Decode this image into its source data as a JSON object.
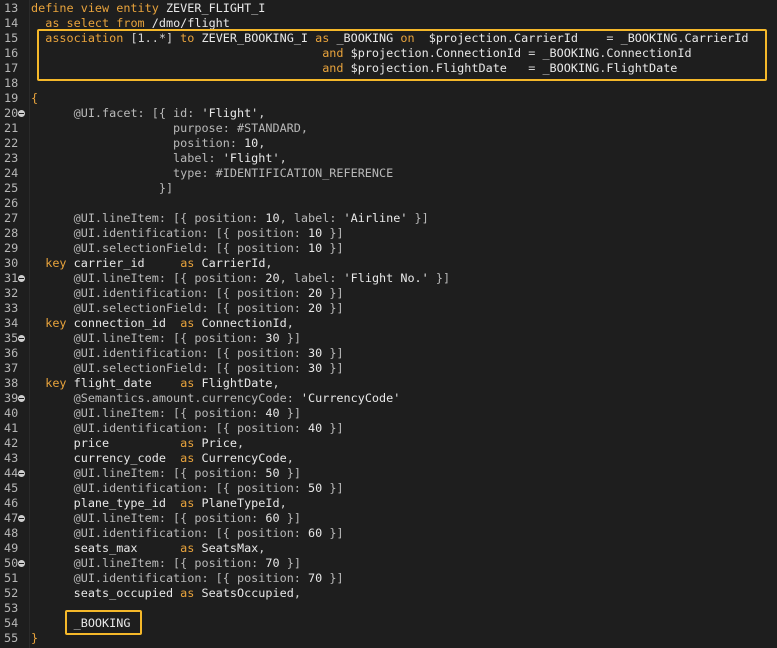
{
  "editor": {
    "lines": [
      {
        "n": "13",
        "fold": false,
        "tokens": [
          [
            "kw",
            "define view entity "
          ],
          [
            "txt",
            "ZEVER_FLIGHT_I"
          ]
        ]
      },
      {
        "n": "14",
        "fold": false,
        "tokens": [
          [
            "txt",
            "  "
          ],
          [
            "kw",
            "as select from "
          ],
          [
            "txt",
            "/dmo/flight"
          ]
        ]
      },
      {
        "n": "15",
        "fold": false,
        "tokens": [
          [
            "txt",
            "  "
          ],
          [
            "kw",
            "association "
          ],
          [
            "pun",
            "[1..*] "
          ],
          [
            "kw",
            "to "
          ],
          [
            "txt",
            "ZEVER_BOOKING_I "
          ],
          [
            "kw",
            "as "
          ],
          [
            "txt",
            "_BOOKING "
          ],
          [
            "kw",
            "on  "
          ],
          [
            "txt",
            "$projection"
          ],
          [
            "pun",
            "."
          ],
          [
            "txt",
            "CarrierId    "
          ],
          [
            "pun",
            "= "
          ],
          [
            "txt",
            "_BOOKING"
          ],
          [
            "pun",
            "."
          ],
          [
            "txt",
            "CarrierId"
          ]
        ]
      },
      {
        "n": "16",
        "fold": false,
        "tokens": [
          [
            "txt",
            "                                         "
          ],
          [
            "kw",
            "and "
          ],
          [
            "txt",
            "$projection"
          ],
          [
            "pun",
            "."
          ],
          [
            "txt",
            "ConnectionId "
          ],
          [
            "pun",
            "= "
          ],
          [
            "txt",
            "_BOOKING"
          ],
          [
            "pun",
            "."
          ],
          [
            "txt",
            "ConnectionId"
          ]
        ]
      },
      {
        "n": "17",
        "fold": false,
        "tokens": [
          [
            "txt",
            "                                         "
          ],
          [
            "kw",
            "and "
          ],
          [
            "txt",
            "$projection"
          ],
          [
            "pun",
            "."
          ],
          [
            "txt",
            "FlightDate   "
          ],
          [
            "pun",
            "= "
          ],
          [
            "txt",
            "_BOOKING"
          ],
          [
            "pun",
            "."
          ],
          [
            "txt",
            "FlightDate"
          ]
        ]
      },
      {
        "n": "18",
        "fold": false,
        "tokens": []
      },
      {
        "n": "19",
        "fold": false,
        "tokens": [
          [
            "op",
            "{"
          ]
        ]
      },
      {
        "n": "20",
        "fold": true,
        "tokens": [
          [
            "txt",
            "      "
          ],
          [
            "ann",
            "@UI.facet: [{ id: "
          ],
          [
            "str",
            "'Flight'"
          ],
          [
            "pun",
            ","
          ]
        ]
      },
      {
        "n": "21",
        "fold": false,
        "tokens": [
          [
            "txt",
            "                    "
          ],
          [
            "ann",
            "purpose: #STANDARD,"
          ]
        ]
      },
      {
        "n": "22",
        "fold": false,
        "tokens": [
          [
            "txt",
            "                    "
          ],
          [
            "ann",
            "position: "
          ],
          [
            "num",
            "10"
          ],
          [
            "pun",
            ","
          ]
        ]
      },
      {
        "n": "23",
        "fold": false,
        "tokens": [
          [
            "txt",
            "                    "
          ],
          [
            "ann",
            "label: "
          ],
          [
            "str",
            "'Flight'"
          ],
          [
            "pun",
            ","
          ]
        ]
      },
      {
        "n": "24",
        "fold": false,
        "tokens": [
          [
            "txt",
            "                    "
          ],
          [
            "ann",
            "type: #IDENTIFICATION_REFERENCE"
          ]
        ]
      },
      {
        "n": "25",
        "fold": false,
        "tokens": [
          [
            "txt",
            "                  "
          ],
          [
            "ann",
            "}]"
          ]
        ]
      },
      {
        "n": "26",
        "fold": false,
        "tokens": []
      },
      {
        "n": "27",
        "fold": false,
        "tokens": [
          [
            "txt",
            "      "
          ],
          [
            "ann",
            "@UI.lineItem: [{ position: "
          ],
          [
            "num",
            "10"
          ],
          [
            "ann",
            ", label: "
          ],
          [
            "str",
            "'Airline'"
          ],
          [
            "ann",
            " }]"
          ]
        ]
      },
      {
        "n": "28",
        "fold": false,
        "tokens": [
          [
            "txt",
            "      "
          ],
          [
            "ann",
            "@UI.identification: [{ position: "
          ],
          [
            "num",
            "10"
          ],
          [
            "ann",
            " }]"
          ]
        ]
      },
      {
        "n": "29",
        "fold": false,
        "tokens": [
          [
            "txt",
            "      "
          ],
          [
            "ann",
            "@UI.selectionField: [{ position: "
          ],
          [
            "num",
            "10"
          ],
          [
            "ann",
            " }]"
          ]
        ]
      },
      {
        "n": "30",
        "fold": false,
        "tokens": [
          [
            "txt",
            "  "
          ],
          [
            "kw",
            "key "
          ],
          [
            "txt",
            "carrier_id     "
          ],
          [
            "kw",
            "as "
          ],
          [
            "txt",
            "CarrierId"
          ],
          [
            "pun",
            ","
          ]
        ]
      },
      {
        "n": "31",
        "fold": true,
        "tokens": [
          [
            "txt",
            "      "
          ],
          [
            "ann",
            "@UI.lineItem: [{ position: "
          ],
          [
            "num",
            "20"
          ],
          [
            "ann",
            ", label: "
          ],
          [
            "str",
            "'Flight No.'"
          ],
          [
            "ann",
            " }]"
          ]
        ]
      },
      {
        "n": "32",
        "fold": false,
        "tokens": [
          [
            "txt",
            "      "
          ],
          [
            "ann",
            "@UI.identification: [{ position: "
          ],
          [
            "num",
            "20"
          ],
          [
            "ann",
            " }]"
          ]
        ]
      },
      {
        "n": "33",
        "fold": false,
        "tokens": [
          [
            "txt",
            "      "
          ],
          [
            "ann",
            "@UI.selectionField: [{ position: "
          ],
          [
            "num",
            "20"
          ],
          [
            "ann",
            " }]"
          ]
        ]
      },
      {
        "n": "34",
        "fold": false,
        "tokens": [
          [
            "txt",
            "  "
          ],
          [
            "kw",
            "key "
          ],
          [
            "txt",
            "connection_id  "
          ],
          [
            "kw",
            "as "
          ],
          [
            "txt",
            "ConnectionId"
          ],
          [
            "pun",
            ","
          ]
        ]
      },
      {
        "n": "35",
        "fold": true,
        "tokens": [
          [
            "txt",
            "      "
          ],
          [
            "ann",
            "@UI.lineItem: [{ position: "
          ],
          [
            "num",
            "30"
          ],
          [
            "ann",
            " }]"
          ]
        ]
      },
      {
        "n": "36",
        "fold": false,
        "tokens": [
          [
            "txt",
            "      "
          ],
          [
            "ann",
            "@UI.identification: [{ position: "
          ],
          [
            "num",
            "30"
          ],
          [
            "ann",
            " }]"
          ]
        ]
      },
      {
        "n": "37",
        "fold": false,
        "tokens": [
          [
            "txt",
            "      "
          ],
          [
            "ann",
            "@UI.selectionField: [{ position: "
          ],
          [
            "num",
            "30"
          ],
          [
            "ann",
            " }]"
          ]
        ]
      },
      {
        "n": "38",
        "fold": false,
        "tokens": [
          [
            "txt",
            "  "
          ],
          [
            "kw",
            "key "
          ],
          [
            "txt",
            "flight_date    "
          ],
          [
            "kw",
            "as "
          ],
          [
            "txt",
            "FlightDate"
          ],
          [
            "pun",
            ","
          ]
        ]
      },
      {
        "n": "39",
        "fold": true,
        "tokens": [
          [
            "txt",
            "      "
          ],
          [
            "ann",
            "@Semantics.amount.currencyCode: "
          ],
          [
            "str",
            "'CurrencyCode'"
          ]
        ]
      },
      {
        "n": "40",
        "fold": false,
        "tokens": [
          [
            "txt",
            "      "
          ],
          [
            "ann",
            "@UI.lineItem: [{ position: "
          ],
          [
            "num",
            "40"
          ],
          [
            "ann",
            " }]"
          ]
        ]
      },
      {
        "n": "41",
        "fold": false,
        "tokens": [
          [
            "txt",
            "      "
          ],
          [
            "ann",
            "@UI.identification: [{ position: "
          ],
          [
            "num",
            "40"
          ],
          [
            "ann",
            " }]"
          ]
        ]
      },
      {
        "n": "42",
        "fold": false,
        "tokens": [
          [
            "txt",
            "      price          "
          ],
          [
            "kw",
            "as "
          ],
          [
            "txt",
            "Price"
          ],
          [
            "pun",
            ","
          ]
        ]
      },
      {
        "n": "43",
        "fold": false,
        "tokens": [
          [
            "txt",
            "      currency_code  "
          ],
          [
            "kw",
            "as "
          ],
          [
            "txt",
            "CurrencyCode"
          ],
          [
            "pun",
            ","
          ]
        ]
      },
      {
        "n": "44",
        "fold": true,
        "tokens": [
          [
            "txt",
            "      "
          ],
          [
            "ann",
            "@UI.lineItem: [{ position: "
          ],
          [
            "num",
            "50"
          ],
          [
            "ann",
            " }]"
          ]
        ]
      },
      {
        "n": "45",
        "fold": false,
        "tokens": [
          [
            "txt",
            "      "
          ],
          [
            "ann",
            "@UI.identification: [{ position: "
          ],
          [
            "num",
            "50"
          ],
          [
            "ann",
            " }]"
          ]
        ]
      },
      {
        "n": "46",
        "fold": false,
        "tokens": [
          [
            "txt",
            "      plane_type_id  "
          ],
          [
            "kw",
            "as "
          ],
          [
            "txt",
            "PlaneTypeId"
          ],
          [
            "pun",
            ","
          ]
        ]
      },
      {
        "n": "47",
        "fold": true,
        "tokens": [
          [
            "txt",
            "      "
          ],
          [
            "ann",
            "@UI.lineItem: [{ position: "
          ],
          [
            "num",
            "60"
          ],
          [
            "ann",
            " }]"
          ]
        ]
      },
      {
        "n": "48",
        "fold": false,
        "tokens": [
          [
            "txt",
            "      "
          ],
          [
            "ann",
            "@UI.identification: [{ position: "
          ],
          [
            "num",
            "60"
          ],
          [
            "ann",
            " }]"
          ]
        ]
      },
      {
        "n": "49",
        "fold": false,
        "tokens": [
          [
            "txt",
            "      seats_max      "
          ],
          [
            "kw",
            "as "
          ],
          [
            "txt",
            "SeatsMax"
          ],
          [
            "pun",
            ","
          ]
        ]
      },
      {
        "n": "50",
        "fold": true,
        "tokens": [
          [
            "txt",
            "      "
          ],
          [
            "ann",
            "@UI.lineItem: [{ position: "
          ],
          [
            "num",
            "70"
          ],
          [
            "ann",
            " }]"
          ]
        ]
      },
      {
        "n": "51",
        "fold": false,
        "tokens": [
          [
            "txt",
            "      "
          ],
          [
            "ann",
            "@UI.identification: [{ position: "
          ],
          [
            "num",
            "70"
          ],
          [
            "ann",
            " }]"
          ]
        ]
      },
      {
        "n": "52",
        "fold": false,
        "tokens": [
          [
            "txt",
            "      seats_occupied "
          ],
          [
            "kw",
            "as "
          ],
          [
            "txt",
            "SeatsOccupied"
          ],
          [
            "pun",
            ","
          ]
        ]
      },
      {
        "n": "53",
        "fold": false,
        "tokens": []
      },
      {
        "n": "54",
        "fold": false,
        "tokens": [
          [
            "txt",
            "      _BOOKING"
          ]
        ]
      },
      {
        "n": "55",
        "fold": false,
        "tokens": [
          [
            "op",
            "}"
          ]
        ]
      }
    ]
  },
  "colors": {
    "background": "#1e1e1e",
    "keyword": "#e8a33c",
    "highlight_border": "#f5b82a"
  }
}
